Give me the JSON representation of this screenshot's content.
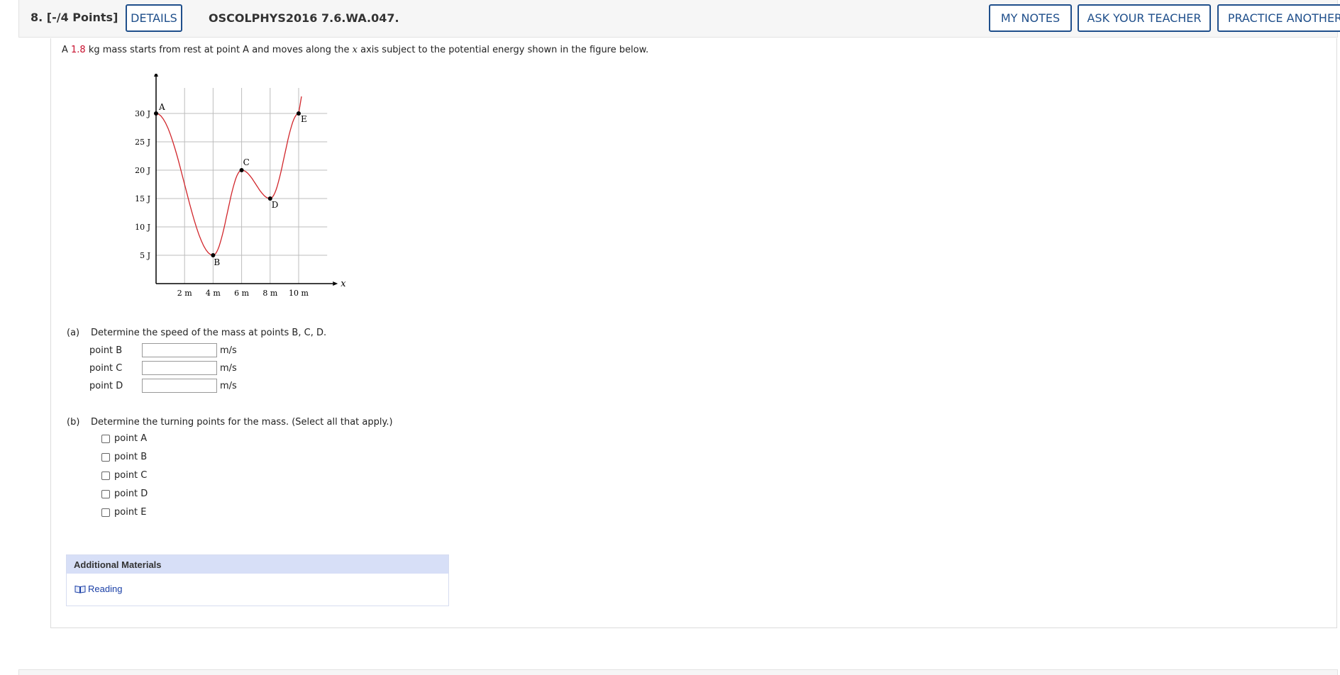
{
  "header": {
    "question_number": "8.",
    "points": "[-/4 Points]",
    "details_label": "DETAILS",
    "question_code": "OSCOLPHYS2016 7.6.WA.047.",
    "my_notes_label": "MY NOTES",
    "ask_teacher_label": "ASK YOUR TEACHER",
    "practice_label": "PRACTICE ANOTHER"
  },
  "prompt": {
    "prefix": "A ",
    "mass": "1.8",
    "middle": " kg mass starts from rest at point A and moves along the ",
    "var": "x",
    "suffix": " axis subject to the potential energy shown in the figure below."
  },
  "chart_data": {
    "type": "line",
    "ylabel": "PE",
    "xlabel": "x",
    "x_ticks": [
      "2 m",
      "4 m",
      "6 m",
      "8 m",
      "10 m"
    ],
    "y_ticks": [
      "5 J",
      "10 J",
      "15 J",
      "20 J",
      "25 J",
      "30 J"
    ],
    "xlim": [
      0,
      12
    ],
    "ylim": [
      0,
      35
    ],
    "grid": true,
    "points": [
      {
        "label": "A",
        "x": 0,
        "y": 30
      },
      {
        "label": "B",
        "x": 4,
        "y": 5
      },
      {
        "label": "C",
        "x": 6,
        "y": 20
      },
      {
        "label": "D",
        "x": 8,
        "y": 15
      },
      {
        "label": "E",
        "x": 10,
        "y": 30
      }
    ],
    "curve_color": "#d1262b"
  },
  "part_a": {
    "label": "(a)",
    "question": "Determine the speed of the mass at points B, C, D.",
    "rows": [
      {
        "name": "point B",
        "value": "",
        "unit": "m/s"
      },
      {
        "name": "point C",
        "value": "",
        "unit": "m/s"
      },
      {
        "name": "point D",
        "value": "",
        "unit": "m/s"
      }
    ]
  },
  "part_b": {
    "label": "(b)",
    "question": "Determine the turning points for the mass. (Select all that apply.)",
    "options": [
      "point A",
      "point B",
      "point C",
      "point D",
      "point E"
    ]
  },
  "additional": {
    "title": "Additional Materials",
    "link": "Reading"
  }
}
